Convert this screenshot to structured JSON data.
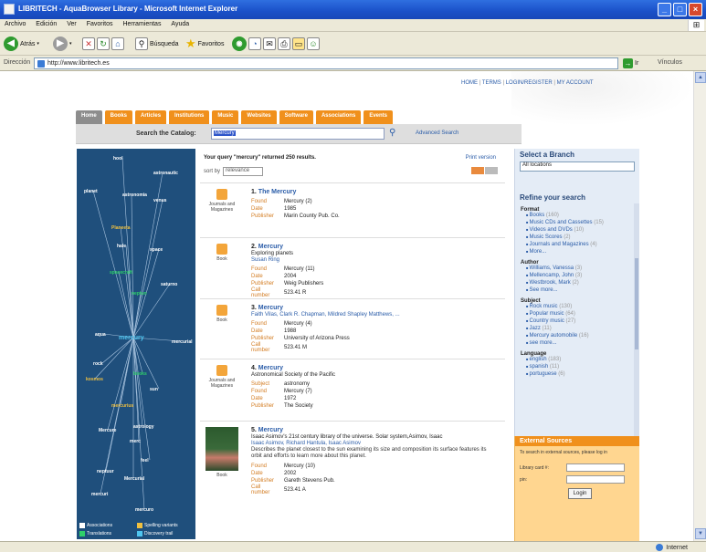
{
  "window": {
    "title": "LIBRITECH - AquaBrowser Library - Microsoft Internet Explorer"
  },
  "menu": [
    "Archivo",
    "Edición",
    "Ver",
    "Favoritos",
    "Herramientas",
    "Ayuda"
  ],
  "toolbar": {
    "back": "Atrás",
    "search": "Búsqueda",
    "favorites": "Favoritos"
  },
  "address": {
    "label": "Dirección",
    "url": "http://www.libritech.es",
    "go": "Ir",
    "links": "Vínculos"
  },
  "site": {
    "toplinks": [
      "HOME",
      "TERMS",
      "LOGIN/REGISTER",
      "MY ACCOUNT"
    ],
    "tabs": [
      "Home",
      "Books",
      "Articles",
      "Institutions",
      "Music",
      "Websites",
      "Software",
      "Associations",
      "Events"
    ],
    "search_label": "Search the Catalog:",
    "search_value": "Mercury",
    "advanced": "Advanced Search"
  },
  "cloud": {
    "center": "mercury",
    "words": [
      "hool",
      "astronautic",
      "planet",
      "astronomia",
      "venus",
      "Planeeta",
      "hale",
      "space",
      "spacecraft",
      "saturno",
      "neptun",
      "aqua",
      "mercurial",
      "rock",
      "books",
      "kosmos",
      "sun",
      "mercurius",
      "astrology",
      "Mercure",
      "merc",
      "feel",
      "neptuur",
      "Mercurial",
      "mercuri",
      "mercuro"
    ],
    "legend": [
      "Associations",
      "Spelling variants",
      "Translations",
      "Discovery trail"
    ]
  },
  "results": {
    "header": "Your query \"mercury\" returned 250 results.",
    "print": "Print version",
    "sort_label": "sort by",
    "sort_value": "relevance",
    "records": [
      {
        "n": "1.",
        "title": "The Mercury",
        "sub": "",
        "authors": "",
        "desc": "",
        "type": "Journals and Magazines",
        "fields": [
          [
            "Found",
            "Mercury (2)"
          ],
          [
            "Date",
            "1985"
          ],
          [
            "Publisher",
            "Marin County Pub. Co."
          ]
        ]
      },
      {
        "n": "2.",
        "title": "Mercury",
        "sub": "Exploring planets",
        "authors": "Susan Ring",
        "desc": "",
        "type": "Book",
        "fields": [
          [
            "Found",
            "Mercury (11)"
          ],
          [
            "Date",
            "2004"
          ],
          [
            "Publisher",
            "Weig Publishers"
          ],
          [
            "Call number",
            "523.41 R"
          ]
        ]
      },
      {
        "n": "3.",
        "title": "Mercury",
        "sub": "",
        "authors": "Faith Vilas, Clark R. Chapman, Mildred Shapley Matthews, ...",
        "desc": "",
        "type": "Book",
        "fields": [
          [
            "Found",
            "Mercury (4)"
          ],
          [
            "Date",
            "1988"
          ],
          [
            "Publisher",
            "University of Arizona Press"
          ],
          [
            "Call number",
            "523.41 M"
          ]
        ]
      },
      {
        "n": "4.",
        "title": "Mercury",
        "sub": "Astronomical Society of the Pacific",
        "authors": "",
        "desc": "",
        "type": "Journals and Magazines",
        "fields": [
          [
            "Subject",
            "astronomy"
          ],
          [
            "Found",
            "Mercury (7)"
          ],
          [
            "Date",
            "1972"
          ],
          [
            "Publisher",
            "The Society"
          ]
        ]
      },
      {
        "n": "5.",
        "title": "Mercury",
        "sub": "Isaac Asimov's 21st century library of the universe. Solar system,Asimov, Isaac",
        "authors": "Isaac Asimov, Richard Hantula, Isaac Asimov",
        "desc": "Describes the planet closest to the sun examining its size and composition its surface features its orbit and efforts to learn more about this planet.",
        "type": "Book",
        "fields": [
          [
            "Found",
            "Mercury (10)"
          ],
          [
            "Date",
            "2002"
          ],
          [
            "Publisher",
            "Gareth Stevens Pub."
          ],
          [
            "Call number",
            "523.41 A"
          ]
        ]
      }
    ]
  },
  "branch": {
    "heading": "Select a Branch",
    "value": "All locations"
  },
  "refine": {
    "heading": "Refine your search",
    "groups": [
      {
        "name": "Format",
        "items": [
          [
            "Books",
            "(160)"
          ],
          [
            "Music CDs and Cassettes",
            "(15)"
          ],
          [
            "Videos and DVDs",
            "(10)"
          ],
          [
            "Music Scores",
            "(2)"
          ],
          [
            "Journals and Magazines",
            "(4)"
          ],
          [
            "More...",
            ""
          ]
        ]
      },
      {
        "name": "Author",
        "items": [
          [
            "Williams, Vanessa",
            "(3)"
          ],
          [
            "Mellencamp, John",
            "(3)"
          ],
          [
            "Westbrook, Mark",
            "(2)"
          ],
          [
            "See more...",
            ""
          ]
        ]
      },
      {
        "name": "Subject",
        "items": [
          [
            "Rock music",
            "(130)"
          ],
          [
            "Popular music",
            "(64)"
          ],
          [
            "Country music",
            "(27)"
          ],
          [
            "Jazz",
            "(11)"
          ],
          [
            "Mercury automobile",
            "(16)"
          ],
          [
            "see more...",
            ""
          ]
        ]
      },
      {
        "name": "Language",
        "items": [
          [
            "english",
            "(183)"
          ],
          [
            "spanish",
            "(11)"
          ],
          [
            "portuguese",
            "(6)"
          ]
        ]
      }
    ]
  },
  "external": {
    "heading": "External Sources",
    "intro": "To search in external sources, please log in",
    "card": "Library card #:",
    "pin": "pin:",
    "login": "Login"
  },
  "status": {
    "zone": "Internet"
  }
}
